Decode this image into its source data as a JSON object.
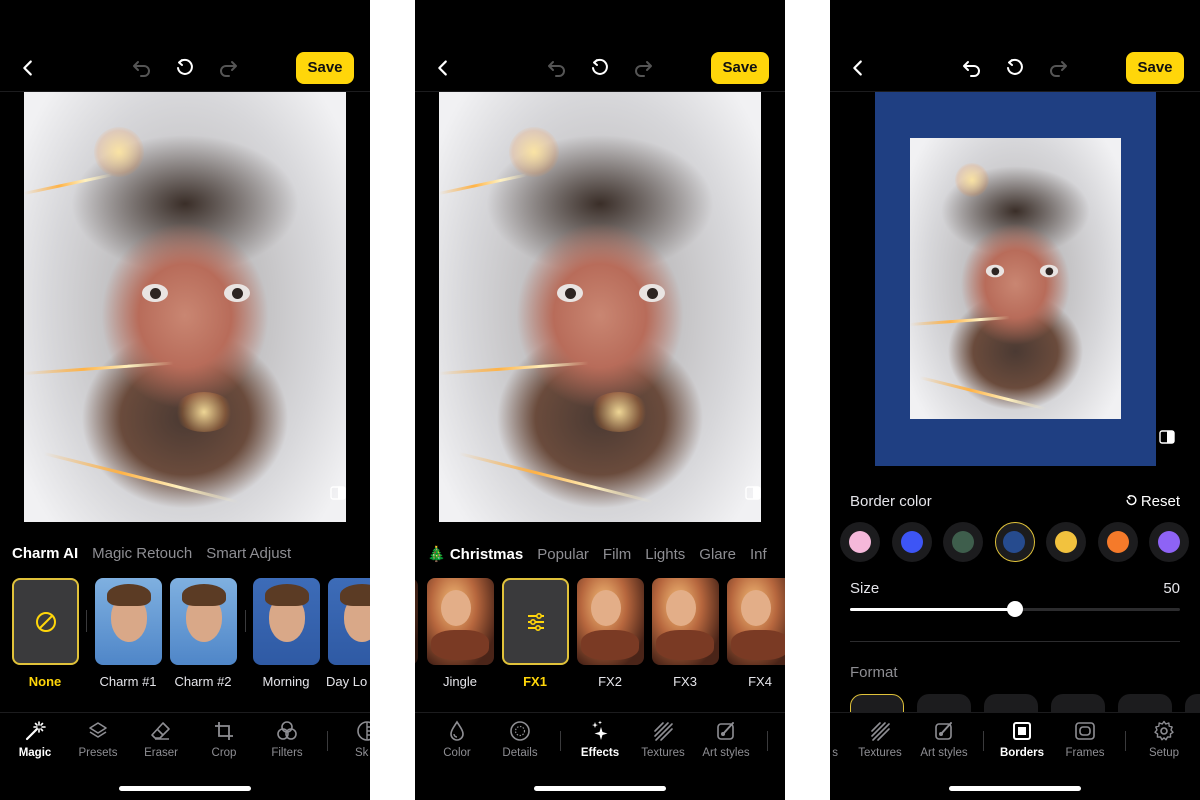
{
  "colors": {
    "accent": "#FFD60A",
    "selection_ring": "#E0C23A",
    "background": "#000000",
    "border_selected": "#1F3F82"
  },
  "panels": [
    {
      "topbar": {
        "back_icon": "chevron-left-icon",
        "undo_enabled": false,
        "reset_icon": "rotate-ccw-icon",
        "redo_enabled": false,
        "save_label": "Save"
      },
      "compare_icon": "compare-split-icon",
      "category_tabs": [
        {
          "label": "Charm AI",
          "active": true
        },
        {
          "label": "Magic Retouch",
          "active": false
        },
        {
          "label": "Smart Adjust",
          "active": false
        }
      ],
      "presets": [
        {
          "label": "None",
          "selected": true,
          "icon": "disabled-circle-icon"
        },
        {
          "label": "Charm #1",
          "selected": false
        },
        {
          "label": "Charm #2",
          "selected": false
        },
        {
          "label": "Morning",
          "selected": false
        },
        {
          "label": "Day Lo",
          "selected": false
        }
      ],
      "toolbar": [
        {
          "label": "Magic",
          "icon": "magic-wand-icon",
          "active": true
        },
        {
          "label": "Presets",
          "icon": "layers-icon",
          "active": false
        },
        {
          "label": "Eraser",
          "icon": "eraser-icon",
          "active": false
        },
        {
          "label": "Crop",
          "icon": "crop-icon",
          "active": false
        },
        {
          "label": "Filters",
          "icon": "filters-circles-icon",
          "active": false
        },
        {
          "label": "Sk",
          "icon": "skin-icon",
          "active": false
        }
      ]
    },
    {
      "topbar": {
        "back_icon": "chevron-left-icon",
        "undo_enabled": false,
        "reset_icon": "rotate-ccw-icon",
        "redo_enabled": false,
        "save_label": "Save"
      },
      "compare_icon": "compare-split-icon",
      "category_tabs": [
        {
          "label": "🎄 Christmas",
          "active": true
        },
        {
          "label": "Popular",
          "active": false
        },
        {
          "label": "Film",
          "active": false
        },
        {
          "label": "Lights",
          "active": false
        },
        {
          "label": "Glare",
          "active": false
        },
        {
          "label": "Inf",
          "active": false
        }
      ],
      "presets": [
        {
          "label": "Jingle",
          "selected": false
        },
        {
          "label": "FX1",
          "selected": true,
          "icon": "sliders-icon"
        },
        {
          "label": "FX2",
          "selected": false
        },
        {
          "label": "FX3",
          "selected": false
        },
        {
          "label": "FX4",
          "selected": false
        }
      ],
      "toolbar": [
        {
          "label": "Color",
          "icon": "droplet-icon",
          "active": false
        },
        {
          "label": "Details",
          "icon": "details-dial-icon",
          "active": false
        },
        {
          "label": "Effects",
          "icon": "sparkles-icon",
          "active": true
        },
        {
          "label": "Textures",
          "icon": "textures-stripes-icon",
          "active": false
        },
        {
          "label": "Art styles",
          "icon": "art-brush-icon",
          "active": false
        }
      ]
    },
    {
      "topbar": {
        "back_icon": "chevron-left-icon",
        "undo_enabled": true,
        "reset_icon": "rotate-ccw-icon",
        "redo_enabled": false,
        "save_label": "Save"
      },
      "compare_icon": "compare-split-icon",
      "border_color": {
        "title": "Border color",
        "reset_label": "Reset",
        "swatches": [
          {
            "name": "pink",
            "hex": "#F5B8DA",
            "selected": false
          },
          {
            "name": "blue",
            "hex": "#3D55F5",
            "selected": false
          },
          {
            "name": "green",
            "hex": "#3E5E4C",
            "selected": false
          },
          {
            "name": "navy",
            "hex": "#264B8E",
            "selected": true
          },
          {
            "name": "yellow",
            "hex": "#F2C23E",
            "selected": false
          },
          {
            "name": "orange",
            "hex": "#F57A2A",
            "selected": false
          },
          {
            "name": "purple",
            "hex": "#8E63F5",
            "selected": false
          }
        ]
      },
      "size": {
        "label": "Size",
        "value": "50",
        "fraction": 0.5
      },
      "format": {
        "title": "Format"
      },
      "toolbar": [
        {
          "label": "s",
          "icon": "",
          "active": false
        },
        {
          "label": "Textures",
          "icon": "textures-stripes-icon",
          "active": false
        },
        {
          "label": "Art styles",
          "icon": "art-brush-icon",
          "active": false
        },
        {
          "label": "Borders",
          "icon": "border-square-icon",
          "active": true
        },
        {
          "label": "Frames",
          "icon": "frame-icon",
          "active": false
        },
        {
          "label": "Setup",
          "icon": "gear-icon",
          "active": false
        }
      ]
    }
  ]
}
